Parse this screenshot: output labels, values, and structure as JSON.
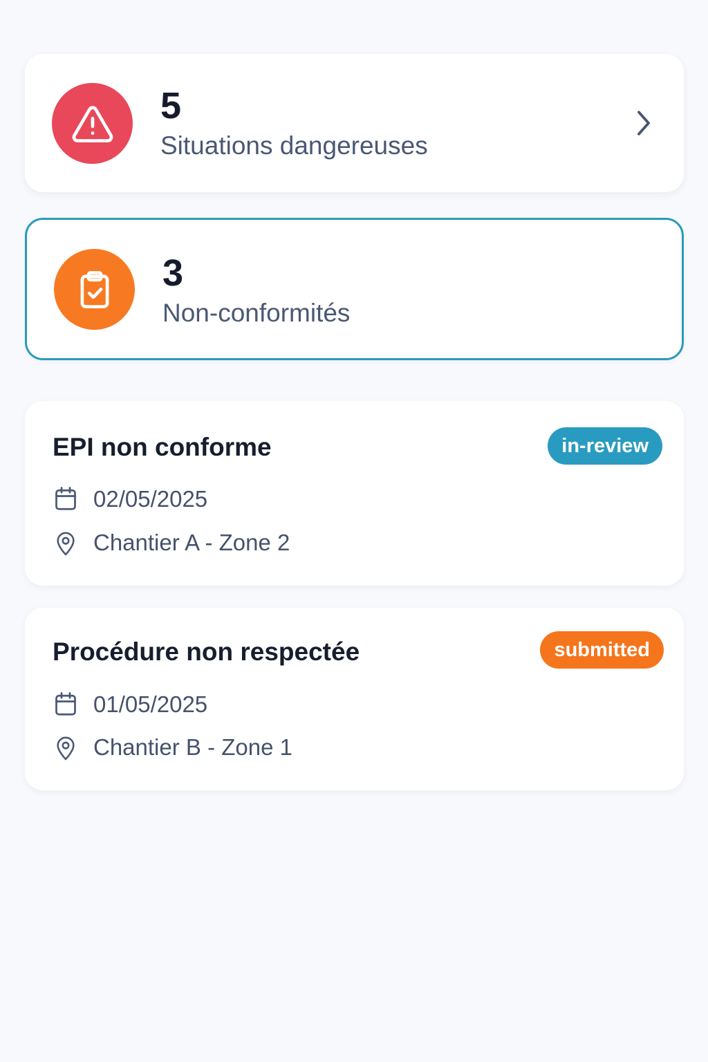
{
  "colors": {
    "danger": "#e8485a",
    "warning": "#f77a22",
    "in_review": "#2a9bc0",
    "submitted": "#f5751c",
    "selected_border": "#2a9bb8"
  },
  "stats": [
    {
      "count": "5",
      "label": "Situations dangereuses",
      "icon": "warning-triangle-icon"
    },
    {
      "count": "3",
      "label": "Non-conformités",
      "icon": "clipboard-check-icon"
    }
  ],
  "reports": [
    {
      "title": "EPI non conforme",
      "status": "in-review",
      "date": "02/05/2025",
      "location": "Chantier A - Zone 2"
    },
    {
      "title": "Procédure non respectée",
      "status": "submitted",
      "date": "01/05/2025",
      "location": "Chantier B - Zone 1"
    }
  ]
}
